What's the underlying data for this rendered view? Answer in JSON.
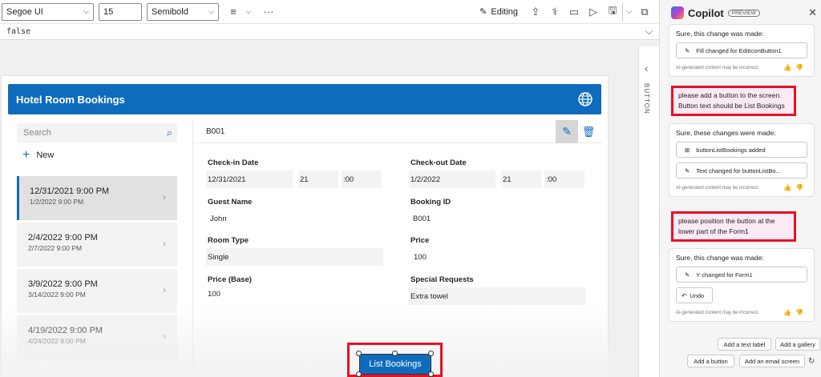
{
  "toolbar": {
    "font_family": "Segoe UI",
    "font_size": "15",
    "font_weight": "Semibold",
    "editing_label": "Editing"
  },
  "formula": {
    "value": "false"
  },
  "app": {
    "header_title": "Hotel Room Bookings",
    "search_placeholder": "Search",
    "new_label": "New",
    "gallery_items": [
      {
        "checkin": "12/31/2021 9:00 PM",
        "checkout": "1/2/2022 9:00 PM",
        "selected": true
      },
      {
        "checkin": "2/4/2022 9:00 PM",
        "checkout": "2/7/2022 9:00 PM",
        "selected": false
      },
      {
        "checkin": "3/9/2022 9:00 PM",
        "checkout": "3/14/2022 9:00 PM",
        "selected": false
      },
      {
        "checkin": "4/19/2022 9:00 PM",
        "checkout": "4/24/2022 9:00 PM",
        "selected": false
      }
    ],
    "form": {
      "record_title": "B001",
      "checkin_label": "Check-in Date",
      "checkin_date": "12/31/2021",
      "checkin_hour": "21",
      "checkin_min": "00",
      "checkout_label": "Check-out Date",
      "checkout_date": "1/2/2022",
      "checkout_hour": "21",
      "checkout_min": "00",
      "guest_label": "Guest Name",
      "guest_value": "John",
      "booking_label": "Booking ID",
      "booking_value": "B001",
      "room_label": "Room Type",
      "room_value": "Single",
      "price_label": "Price",
      "price_value": "100",
      "price_base_label": "Price (Base)",
      "price_base_value": "100",
      "special_label": "Special Requests",
      "special_value": "Extra towel"
    },
    "list_bookings_button": "List Bookings"
  },
  "right_strip": {
    "label": "BUTTON"
  },
  "copilot": {
    "title": "Copilot",
    "preview_badge": "PREVIEW",
    "disclaimer": "AI-generated content may be incorrect.",
    "msg1_text": "Sure, this change was made:",
    "msg1_chip": "Fill changed for EditIconButton1",
    "user1": "please add a button to the screen. Button text should be List Bookings",
    "msg2_text": "Sure, these changes were made:",
    "msg2_chip1": "buttonListBookings added",
    "msg2_chip2": "Text changed for buttonListBo...",
    "user2": "please position the button at the lower part of the Form1",
    "msg3_text": "Sure, this change was made:",
    "msg3_chip": "Y changed for Form1",
    "undo_label": "Undo",
    "suggestions": [
      "Add a text label",
      "Add a gallery",
      "Add a button",
      "Add an email screen"
    ]
  }
}
